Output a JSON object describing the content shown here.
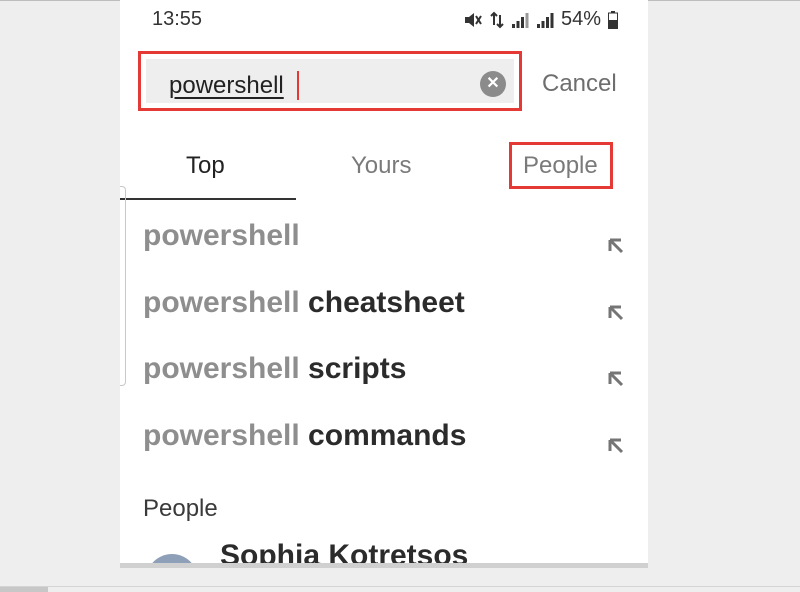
{
  "status_bar": {
    "time": "13:55",
    "battery": "54%",
    "icons": [
      "mute-vibrate-icon",
      "data-transfer-icon",
      "signal-icon",
      "roaming-signal-icon",
      "battery-icon"
    ]
  },
  "search": {
    "value": "powershell",
    "clear_icon": "clear-icon",
    "cancel_label": "Cancel"
  },
  "tabs": [
    {
      "label": "Top",
      "active": true
    },
    {
      "label": "Yours",
      "active": false
    },
    {
      "label": "People",
      "active": false
    }
  ],
  "suggestions": [
    {
      "prefix": "powershell",
      "rest": ""
    },
    {
      "prefix": "powershell",
      "rest": " cheatsheet"
    },
    {
      "prefix": "powershell",
      "rest": " scripts"
    },
    {
      "prefix": "powershell",
      "rest": " commands"
    }
  ],
  "people_section": {
    "title": "People",
    "results": [
      {
        "name": "Sophia Kotretsos"
      }
    ]
  },
  "colors": {
    "highlight": "#e53935",
    "field_bg": "#eeeeee",
    "muted_text": "#8e8e8e"
  }
}
